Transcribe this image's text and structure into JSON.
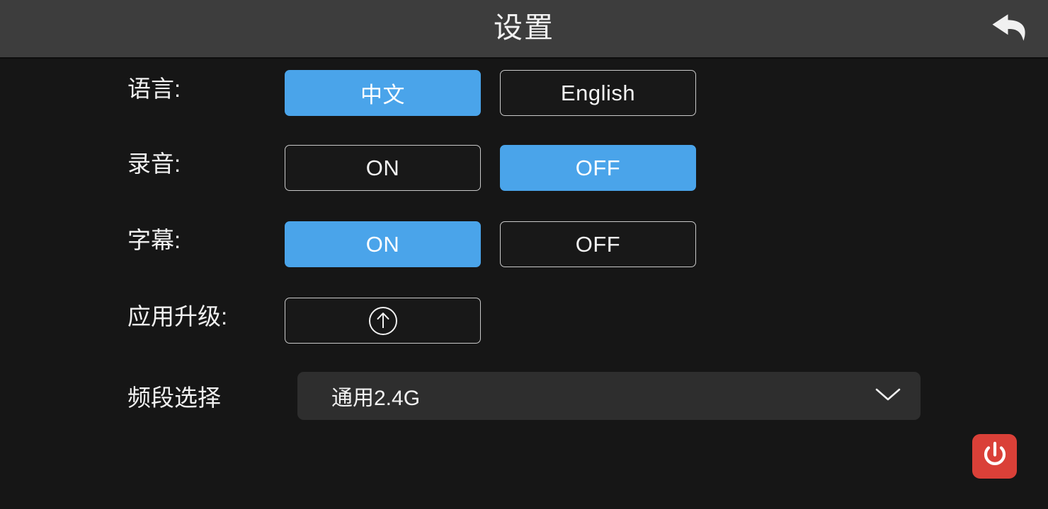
{
  "header": {
    "title": "设置",
    "back_icon": "back-arrow-icon"
  },
  "settings": {
    "language": {
      "label": "语言:",
      "options": [
        {
          "value": "中文",
          "selected": true
        },
        {
          "value": "English",
          "selected": false
        }
      ]
    },
    "recording": {
      "label": "录音:",
      "options": [
        {
          "value": "ON",
          "selected": false
        },
        {
          "value": "OFF",
          "selected": true
        }
      ]
    },
    "subtitle": {
      "label": "字幕:",
      "options": [
        {
          "value": "ON",
          "selected": true
        },
        {
          "value": "OFF",
          "selected": false
        }
      ]
    },
    "app_upgrade": {
      "label": "应用升级:",
      "button_icon": "upload-circle-arrow-icon"
    },
    "band_select": {
      "label": "频段选择",
      "value": "通用2.4G",
      "chevron_icon": "chevron-down-icon"
    }
  },
  "power": {
    "icon": "power-icon"
  },
  "colors": {
    "accent_blue": "#4aa4ea",
    "header_bg": "#3d3d3d",
    "page_bg": "#161616",
    "dropdown_bg": "#2e2e2e",
    "power_red": "#da4038",
    "text": "#f2f2f2"
  }
}
